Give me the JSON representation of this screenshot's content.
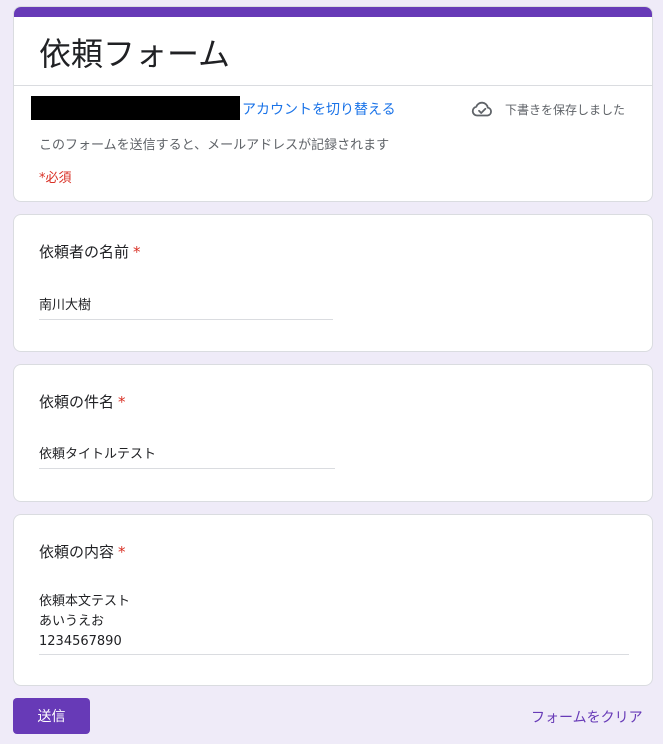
{
  "colors": {
    "accent": "#673ab7",
    "background": "#efebf8",
    "link": "#1a73e8",
    "required": "#d93025",
    "muted_text": "#5f6368"
  },
  "header": {
    "title": "依頼フォーム",
    "switch_account": "アカウントを切り替える",
    "draft_status": "下書きを保存しました",
    "draft_icon": "cloud-check-icon",
    "record_notice": "このフォームを送信すると、メールアドレスが記録されます",
    "required_note": "*必須"
  },
  "questions": [
    {
      "title": "依頼者の名前",
      "required_mark": "*",
      "answer": "南川大樹"
    },
    {
      "title": "依頼の件名",
      "required_mark": "*",
      "answer": "依頼タイトルテスト"
    },
    {
      "title": "依頼の内容",
      "required_mark": "*",
      "answer": "依頼本文テスト\nあいうえお\n1234567890"
    }
  ],
  "actions": {
    "submit_label": "送信",
    "clear_label": "フォームをクリア"
  }
}
